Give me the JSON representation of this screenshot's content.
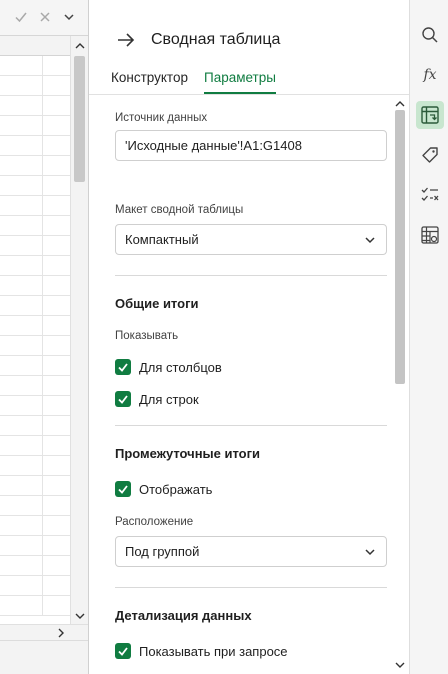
{
  "pane": {
    "title": "Сводная таблица",
    "tabs": [
      {
        "label": "Конструктор",
        "active": false
      },
      {
        "label": "Параметры",
        "active": true
      }
    ]
  },
  "data_source": {
    "label": "Источник данных",
    "value": "'Исходные данные'!A1:G1408"
  },
  "layout": {
    "label": "Макет сводной таблицы",
    "selected": "Компактный"
  },
  "grand_totals": {
    "title": "Общие итоги",
    "show_label": "Показывать",
    "columns_label": "Для столбцов",
    "columns_checked": true,
    "rows_label": "Для строк",
    "rows_checked": true
  },
  "subtotals": {
    "title": "Промежуточные итоги",
    "display_label": "Отображать",
    "display_checked": true,
    "position_label": "Расположение",
    "position_selected": "Под группой"
  },
  "drilldown": {
    "title": "Детализация данных",
    "show_on_request_label": "Показывать при запросе",
    "show_on_request_checked": true
  },
  "rail": {
    "items": [
      {
        "icon": "search-icon",
        "active": false
      },
      {
        "icon": "function-icon",
        "active": false
      },
      {
        "icon": "pivot-table-icon",
        "active": true
      },
      {
        "icon": "tag-icon",
        "active": false
      },
      {
        "icon": "checklist-icon",
        "active": false
      },
      {
        "icon": "table-settings-icon",
        "active": false
      }
    ]
  },
  "colors": {
    "accent": "#107c41",
    "active_rail_bg": "#c8e6cf"
  }
}
